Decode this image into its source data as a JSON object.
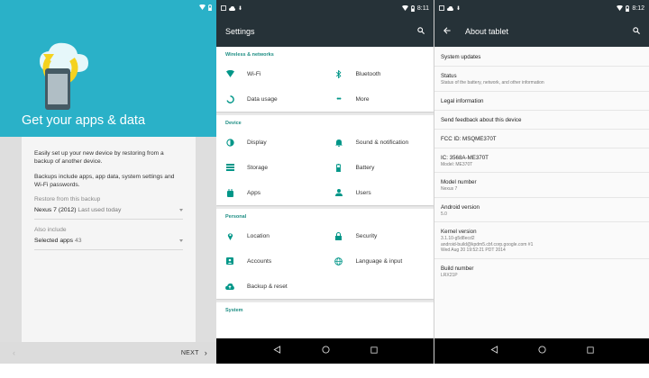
{
  "setup": {
    "title": "Get your apps & data",
    "intro": "Easily set up your new device by restoring from a backup of another device.",
    "detail": "Backups include apps, app data, system settings and Wi-Fi passwords.",
    "restore_label": "Restore from this backup",
    "restore_value": "Nexus 7 (2012)",
    "restore_sub": "Last used today",
    "include_label": "Also include",
    "include_value": "Selected apps",
    "include_count": "43",
    "next_label": "NEXT",
    "hero_color": "#2ab1c8"
  },
  "settings": {
    "time": "8:11",
    "title": "Settings",
    "accent": "#1e8e84",
    "sections": [
      {
        "head": "Wireless & networks",
        "items": [
          "Wi-Fi",
          "Bluetooth",
          "Data usage",
          "More"
        ]
      },
      {
        "head": "Device",
        "items": [
          "Display",
          "Sound & notification",
          "Storage",
          "Battery",
          "Apps",
          "Users"
        ]
      },
      {
        "head": "Personal",
        "items": [
          "Location",
          "Security",
          "Accounts",
          "Language & input",
          "Backup & reset"
        ]
      },
      {
        "head": "System"
      }
    ],
    "icons": [
      "wifi-icon",
      "bluetooth-icon",
      "data-usage-icon",
      "more-icon",
      "display-icon",
      "sound-icon",
      "storage-icon",
      "battery-icon",
      "apps-icon",
      "users-icon",
      "location-icon",
      "security-icon",
      "accounts-icon",
      "language-icon",
      "backup-icon"
    ]
  },
  "about": {
    "time": "8:12",
    "title": "About tablet",
    "items": [
      {
        "title": "System updates",
        "sub": ""
      },
      {
        "title": "Status",
        "sub": "Status of the battery, network, and other information"
      },
      {
        "title": "Legal information",
        "sub": ""
      },
      {
        "title": "Send feedback about this device",
        "sub": ""
      },
      {
        "title": "FCC ID: MSQME370T",
        "sub": ""
      },
      {
        "title": "IC: 3568A-ME370T",
        "sub": "Model: ME370T"
      },
      {
        "title": "Model number",
        "sub": "Nexus 7"
      },
      {
        "title": "Android version",
        "sub": "5.0"
      },
      {
        "title": "Kernel version",
        "sub": "3.1.10-g5d8ecd2",
        "sub2": "android-build@kpdm5.cbf.corp.google.com #1",
        "sub3": "Wed Aug 20 19:52:21 PDT 2014"
      },
      {
        "title": "Build number",
        "sub": "LRX21P"
      }
    ]
  }
}
